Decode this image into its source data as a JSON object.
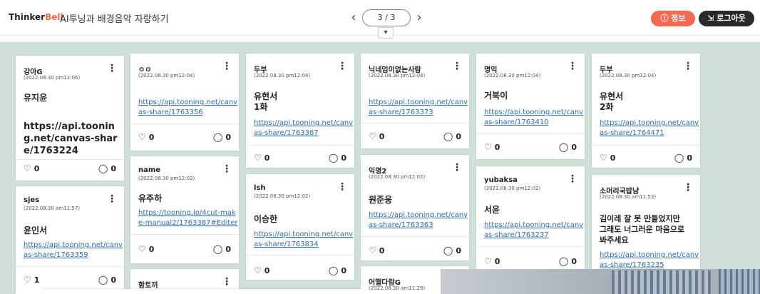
{
  "header": {
    "logo_thinker": "Thinker",
    "logo_bell": "Bell",
    "title": "AI투닝과 배경음악 자랑하기",
    "page_indicator": "3 / 3",
    "prev_icon": "chevron-left-icon",
    "next_icon": "chevron-right-icon",
    "dropdown_icon": "chevron-down-icon",
    "info_label": "정보",
    "logout_label": "로그아웃",
    "accent_color": "#f5694f"
  },
  "cards": [
    {
      "name": "강아G",
      "date": "(2022.08.30 pm12:06)",
      "body": "유지윤",
      "link": "https://api.tooning.net/canvas-share/1763224",
      "likes": "0",
      "comments": "0"
    },
    {
      "name": "sjes",
      "date": "(2022.08.30 am11:57)",
      "body": "윤인서",
      "link": "https://api.tooning.net/canvas-share/1763359",
      "likes": "1",
      "comments": "0"
    },
    {
      "name": "ㅇㅇ",
      "date": "(2022.08.30 pm12:04)",
      "body": "",
      "link": "https://api.tooning.net/canvas-share/1763356",
      "likes": "0",
      "comments": "0"
    },
    {
      "name": "name",
      "date": "(2022.08.30 pm12:02)",
      "body": "유주하",
      "link": "https://tooning.io/4cut-make-manual2/1763387#Editer",
      "likes": "0",
      "comments": "0"
    },
    {
      "name": "함토끼",
      "date": "",
      "body": "",
      "link": "",
      "likes": "",
      "comments": ""
    },
    {
      "name": "두부",
      "date": "(2022.08.30 pm12:04)",
      "body": "유현서\n1화",
      "link": "https://api.tooning.net/canvas-share/1763367",
      "likes": "0",
      "comments": "0"
    },
    {
      "name": "lsh",
      "date": "(2022.08.30 pm12:02)",
      "body": "이승한",
      "link": "https://api.tooning.net/canvas-share/1763834",
      "likes": "0",
      "comments": "0"
    },
    {
      "name": "닉네임이없는사람",
      "date": "(2022.08.30 pm12:04)",
      "body": "",
      "link": "https://api.tooning.net/canvas-share/1763373",
      "likes": "0",
      "comments": "0"
    },
    {
      "name": "익명2",
      "date": "(2022.08.30 pm12:02)",
      "body": "원준웅",
      "link": "https://api.tooning.net/canvas-share/1763363",
      "likes": "0",
      "comments": "0"
    },
    {
      "name": "어떨다람G",
      "date": "(2022.08.30 am11:29)",
      "body": "",
      "link": "",
      "likes": "",
      "comments": ""
    },
    {
      "name": "명익",
      "date": "(2022.08.30 pm12:04)",
      "body": "거북이",
      "link": "https://api.tooning.net/canvas-share/1763410",
      "likes": "0",
      "comments": "0"
    },
    {
      "name": "yubaksa",
      "date": "(2022.08.30 pm12:02)",
      "body": "서윤",
      "link": "https://api.tooning.net/canvas-share/1763237",
      "likes": "0",
      "comments": "0"
    },
    {
      "name": "두부",
      "date": "(2022.08.30 pm12:04)",
      "body": "유현서\n2화",
      "link": "https://api.tooning.net/canvas-share/1764471",
      "likes": "0",
      "comments": "0"
    },
    {
      "name": "소머리국밥냠",
      "date": "(2022.08.30 am11:53)",
      "body": "김이레  잘 못 만들었지만\n그래도 너그러운 마음으로\n봐주세요",
      "link": "https://api.tooning.net/canvas-share/1763235",
      "likes": "",
      "comments": ""
    }
  ]
}
